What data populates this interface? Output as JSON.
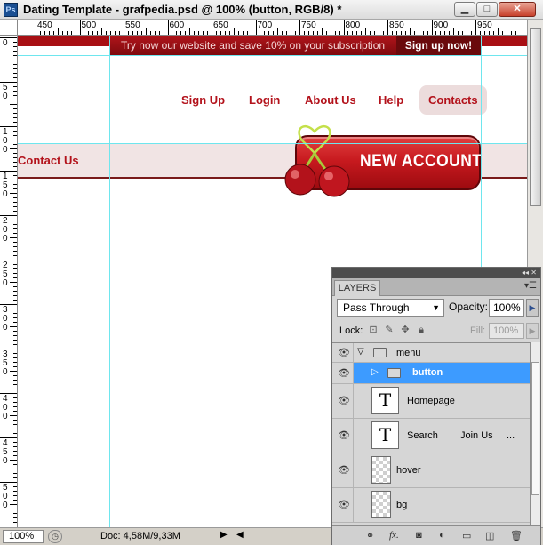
{
  "window": {
    "title": "Dating Template - grafpedia.psd @ 100% (button, RGB/8) *",
    "app_icon": "Ps",
    "minimize_glyph": "▁",
    "maximize_glyph": "□",
    "close_glyph": "✕"
  },
  "rulers": {
    "horizontal": [
      "450",
      "500",
      "550",
      "600",
      "650",
      "700",
      "750",
      "800",
      "850",
      "900",
      "950"
    ],
    "vertical": [
      "0",
      "5\n0",
      "1\n0\n0",
      "1\n5\n0",
      "2\n0\n0",
      "2\n5\n0",
      "3\n0\n0",
      "3\n5\n0",
      "4\n0\n0",
      "4\n5\n0",
      "5\n0\n0"
    ]
  },
  "canvas": {
    "promo_text": "Try now our website and save 10% on your subscription",
    "promo_button": "Sign up now!",
    "nav": [
      "Sign Up",
      "Login",
      "About Us",
      "Help",
      "Contacts"
    ],
    "band_label": "Contact Us",
    "new_account_label": "NEW ACCOUNT",
    "colors": {
      "brand_red": "#a80f14",
      "nav_text": "#b3121b",
      "band_bg": "#f1e4e4"
    }
  },
  "status": {
    "zoom": "100%",
    "doc": "Doc: 4,58M/9,33M"
  },
  "layers_panel": {
    "tab_label": "LAYERS",
    "blend_mode": "Pass Through",
    "opacity_label": "Opacity:",
    "opacity_value": "100%",
    "lock_label": "Lock:",
    "fill_label": "Fill:",
    "fill_value": "100%",
    "layers": [
      {
        "name": "menu",
        "kind": "group",
        "expanded": true
      },
      {
        "name": "button",
        "kind": "group",
        "selected": true
      },
      {
        "name": "Homepage",
        "kind": "text"
      },
      {
        "name": "Search",
        "kind": "text",
        "extra1": "Join Us",
        "extra2": "..."
      },
      {
        "name": "hover",
        "kind": "raster"
      },
      {
        "name": "bg",
        "kind": "raster"
      }
    ],
    "footer_icons": [
      "link-layers-icon",
      "fx-icon",
      "mask-icon",
      "adjustment-icon",
      "new-group-icon",
      "new-layer-icon",
      "trash-icon"
    ]
  }
}
